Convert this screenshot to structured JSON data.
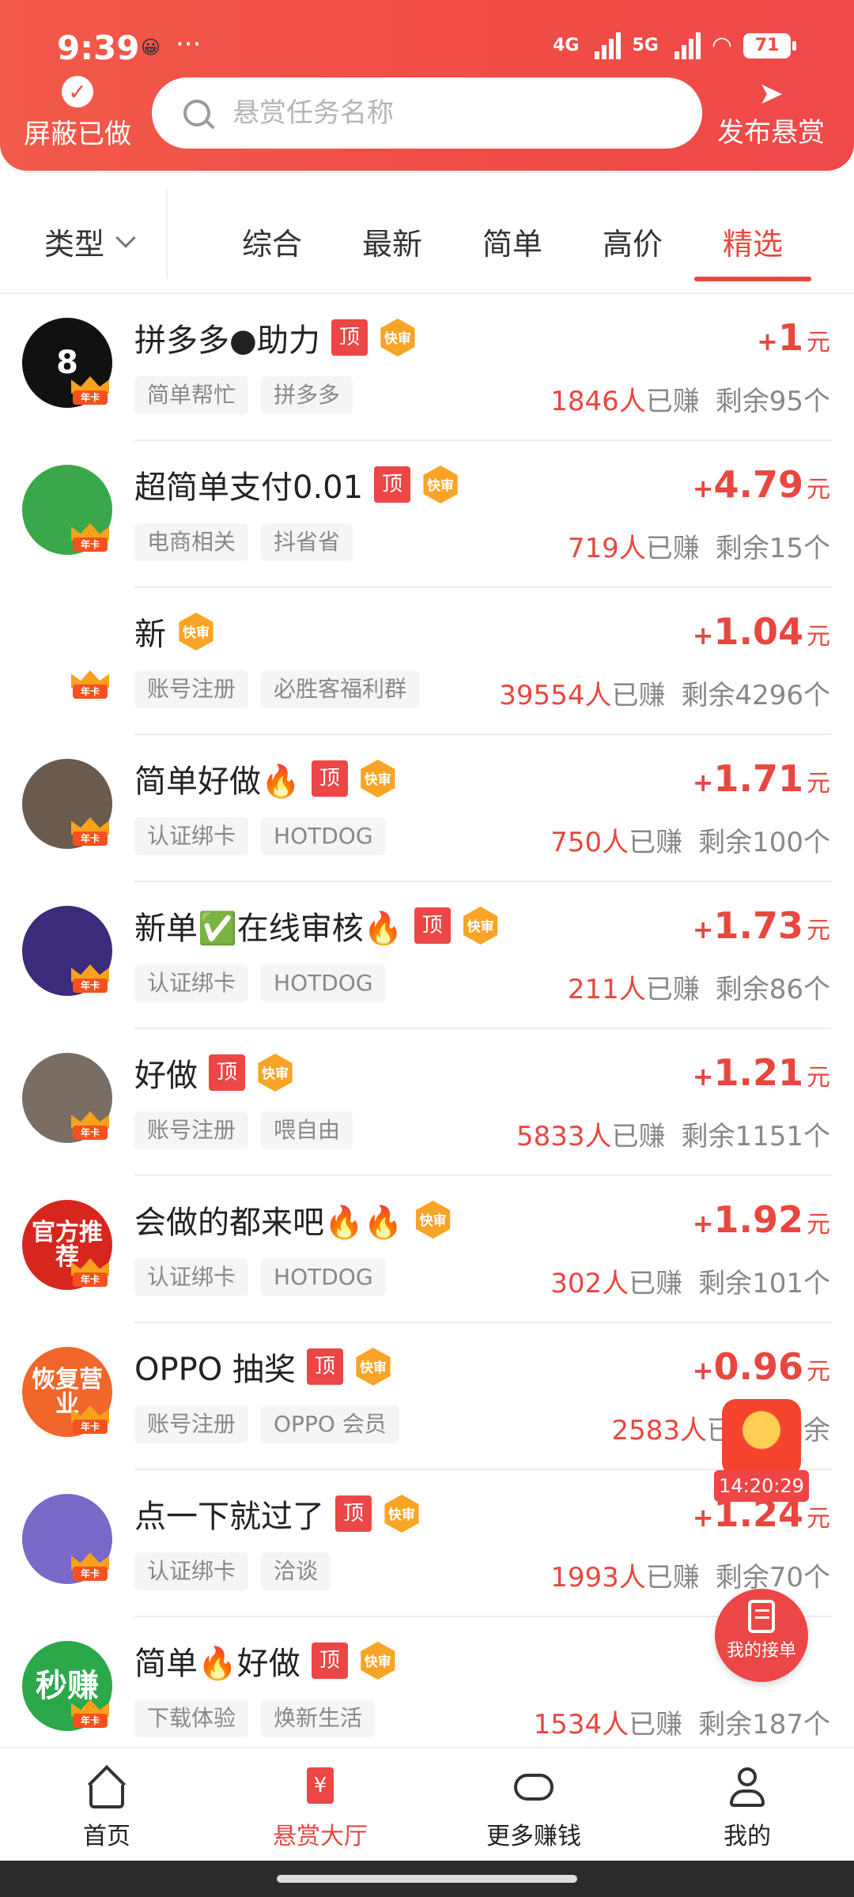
{
  "status": {
    "time": "9:39",
    "dots": "···",
    "net1": "4G",
    "net2": "5G",
    "battery": "71"
  },
  "header": {
    "hide_done_label": "屏蔽已做",
    "search_placeholder": "悬赏任务名称",
    "publish_label": "发布悬赏"
  },
  "filter": {
    "type_label": "类型",
    "tabs": [
      "综合",
      "最新",
      "简单",
      "高价",
      "精选"
    ],
    "active_tab": "精选"
  },
  "badges": {
    "top": "顶",
    "fast": "快审",
    "annual": "年卡"
  },
  "units": {
    "yuan": "元",
    "earned_suffix": "已赚",
    "remain_prefix": "剩余",
    "remain_suffix": "个",
    "person": "人"
  },
  "tasks": [
    {
      "title": "拼多多●助力",
      "tags": [
        "简单帮忙",
        "拼多多"
      ],
      "price_sign": "+",
      "price": "1",
      "earned": "1846",
      "remain": "95",
      "avatar_color": "#111111",
      "avatar_text": "8"
    },
    {
      "title": "超简单支付0.01",
      "tags": [
        "电商相关",
        "抖省省"
      ],
      "price_sign": "+",
      "price": "4.79",
      "earned": "719",
      "remain": "15",
      "avatar_color": "#3aa84a",
      "avatar_text": ""
    },
    {
      "title": "新",
      "tags": [
        "账号注册",
        "必胜客福利群"
      ],
      "price_sign": "+",
      "price": "1.04",
      "earned": "39554",
      "remain": "4296",
      "avatar_color": "#ffffff",
      "avatar_text": ""
    },
    {
      "title": "简单好做🔥",
      "tags": [
        "认证绑卡",
        "HOTDOG"
      ],
      "price_sign": "+",
      "price": "1.71",
      "earned": "750",
      "remain": "100",
      "avatar_color": "#6b5a4e",
      "avatar_text": ""
    },
    {
      "title": "新单✅在线审核🔥",
      "tags": [
        "认证绑卡",
        "HOTDOG"
      ],
      "price_sign": "+",
      "price": "1.73",
      "earned": "211",
      "remain": "86",
      "avatar_color": "#3c2a7a",
      "avatar_text": ""
    },
    {
      "title": "好做",
      "tags": [
        "账号注册",
        "喂自由"
      ],
      "price_sign": "+",
      "price": "1.21",
      "earned": "5833",
      "remain": "1151",
      "avatar_color": "#7a6e64",
      "avatar_text": ""
    },
    {
      "title": "会做的都来吧🔥🔥",
      "tags": [
        "认证绑卡",
        "HOTDOG"
      ],
      "price_sign": "+",
      "price": "1.92",
      "earned": "302",
      "remain": "101",
      "avatar_color": "#d7261e",
      "avatar_text": "官方推荐"
    },
    {
      "title": "OPPO 抽奖",
      "tags": [
        "账号注册",
        "OPPO 会员"
      ],
      "price_sign": "+",
      "price": "0.96",
      "earned": "2583",
      "remain": "",
      "avatar_color": "#f0662b",
      "avatar_text": "恢复营业"
    },
    {
      "title": "点一下就过了",
      "tags": [
        "认证绑卡",
        "洽谈"
      ],
      "price_sign": "+",
      "price": "1.24",
      "earned": "1993",
      "remain": "70",
      "avatar_color": "#7a68c8",
      "avatar_text": ""
    },
    {
      "title": "简单🔥好做",
      "tags": [
        "下载体验",
        "焕新生活"
      ],
      "price_sign": "",
      "price": "",
      "earned": "1534",
      "remain": "187",
      "avatar_color": "#2aa84a",
      "avatar_text": "秒赚"
    }
  ],
  "float": {
    "timer": "14:20:29",
    "orders_label": "我的接单"
  },
  "nav": [
    {
      "label": "首页",
      "icon": "home-icon"
    },
    {
      "label": "悬赏大厅",
      "icon": "hall-icon",
      "active": true
    },
    {
      "label": "更多赚钱",
      "icon": "gamepad-icon"
    },
    {
      "label": "我的",
      "icon": "user-icon"
    }
  ]
}
